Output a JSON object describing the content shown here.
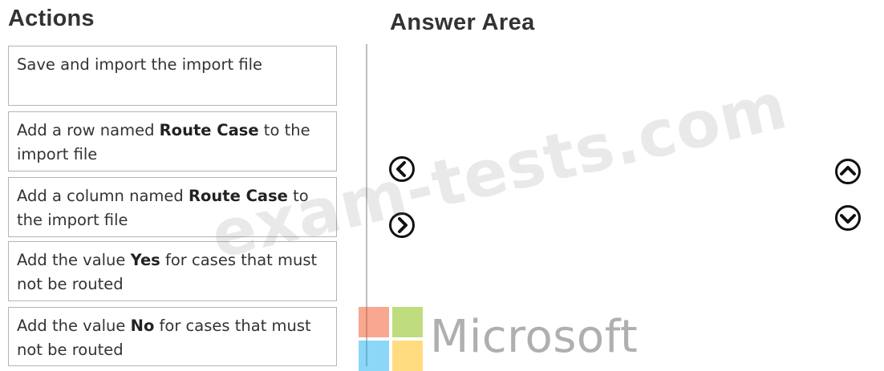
{
  "actions_title": "Actions",
  "answer_title": "Answer Area",
  "actions": [
    {
      "text": "Save and import the import file"
    },
    {
      "before": "Add a row named ",
      "bold": "Route Case",
      "after": " to the import file"
    },
    {
      "before": "Add a column named ",
      "bold": "Route Case",
      "after": " to the import file"
    },
    {
      "before": "Add the value ",
      "bold": "Yes",
      "after": " for cases that must not be routed"
    },
    {
      "before": "Add the value ",
      "bold": "No",
      "after": " for cases that must not be routed"
    }
  ],
  "controls": {
    "move_left": "chevron-left-circle-icon",
    "move_right": "chevron-right-circle-icon",
    "move_up": "chevron-up-circle-icon",
    "move_down": "chevron-down-circle-icon"
  },
  "watermark": "exam-tests.com",
  "logo": {
    "wordmark": "Microsoft"
  }
}
